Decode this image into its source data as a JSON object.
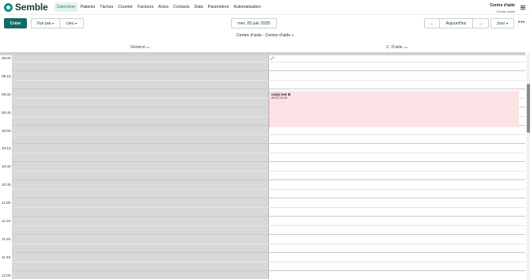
{
  "brand": {
    "name": "Semble",
    "color": "#0e8f7f"
  },
  "nav": {
    "items": [
      {
        "label": "Calendrier",
        "active": true
      },
      {
        "label": "Patients"
      },
      {
        "label": "Tâches"
      },
      {
        "label": "Courrier"
      },
      {
        "label": "Factures"
      },
      {
        "label": "Actes"
      },
      {
        "label": "Contacts"
      },
      {
        "label": "Data"
      },
      {
        "label": "Paramètres"
      },
      {
        "label": "Automatisation"
      }
    ]
  },
  "account": {
    "name": "Centre d'aide",
    "sub": "Centre d'aide"
  },
  "toolbar": {
    "create_label": "Créer",
    "view_by_label": "Vue par",
    "location_label": "Lieu",
    "date_label": "mer. 25 juin 2025",
    "prev_icon": "←",
    "today_label": "Aujourd'hui",
    "next_icon": "→",
    "view_mode_label": "Jour",
    "more_icon": "•••"
  },
  "location_selector": {
    "label": "Centre d'aide - Centre d'aide"
  },
  "columns": [
    {
      "name": "Général",
      "menu": "•••"
    },
    {
      "name": "C. D'aide",
      "menu": "•••"
    }
  ],
  "times": [
    "09:00",
    "09:15",
    "09:30",
    "09:45",
    "10:00",
    "10:15",
    "10:30",
    "10:45",
    "11:00",
    "11:15",
    "11:30",
    "11:45",
    "12:00"
  ],
  "event": {
    "title": "cindy test",
    "time": "09:30-10:00",
    "color": "#fbe2e4"
  },
  "colors": {
    "primary": "#0e6b66",
    "unavailable": "#d8d8d8"
  }
}
